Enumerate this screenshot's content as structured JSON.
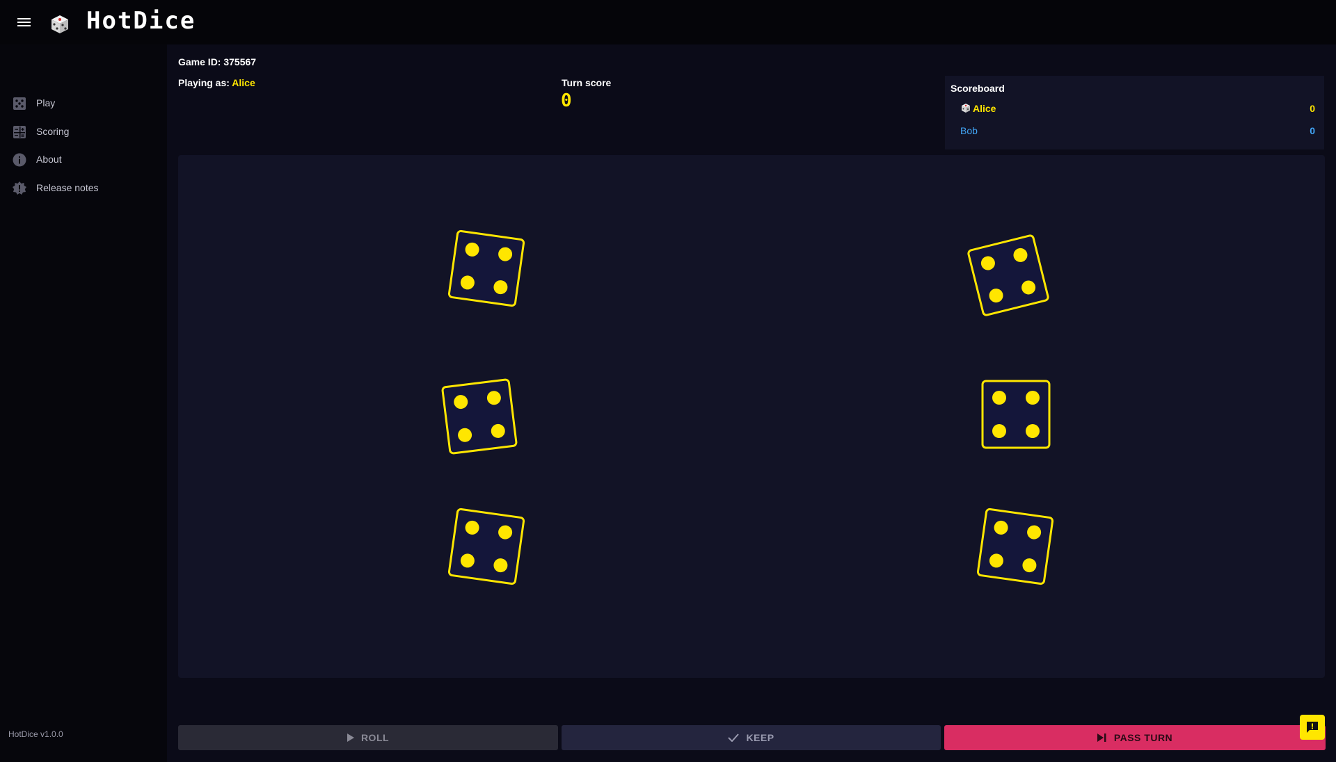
{
  "app": {
    "title": "HotDice",
    "version": "HotDice v1.0.0"
  },
  "sidebar": {
    "items": [
      {
        "label": "Play",
        "icon": "dice-icon"
      },
      {
        "label": "Scoring",
        "icon": "scoring-grid-icon"
      },
      {
        "label": "About",
        "icon": "info-icon"
      },
      {
        "label": "Release notes",
        "icon": "gear-badge-icon"
      }
    ]
  },
  "game": {
    "id_text": "Game ID: 375567",
    "playing_as_label": "Playing as:",
    "player": "Alice",
    "turn_label": "Turn score",
    "turn_value": "0"
  },
  "scoreboard": {
    "title": "Scoreboard",
    "rows": [
      {
        "name": "Alice",
        "score": "0",
        "color": "#ffe600",
        "current": true
      },
      {
        "name": "Bob",
        "score": "0",
        "color": "#42a5f5",
        "current": false
      }
    ]
  },
  "dice": [
    {
      "value": 4
    },
    {
      "value": 4
    },
    {
      "value": 4
    },
    {
      "value": 4
    },
    {
      "value": 4
    },
    {
      "value": 4
    }
  ],
  "buttons": {
    "roll": "ROLL",
    "keep": "KEEP",
    "pass": "PASS TURN"
  },
  "colors": {
    "accent": "#ffe600",
    "pass": "#d92d62",
    "table": "#121326"
  }
}
